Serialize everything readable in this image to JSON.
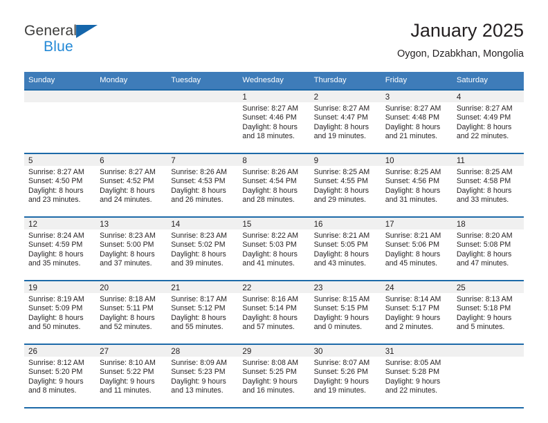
{
  "brand": {
    "line1": "General",
    "line2": "Blue",
    "triangle_color": "#1566ab",
    "line2_color": "#2288d6"
  },
  "header": {
    "title": "January 2025",
    "subtitle": "Oygon, Dzabkhan, Mongolia"
  },
  "theme": {
    "header_bg": "#3e7cb9",
    "row_rule": "#1c69a8",
    "daynum_band": "#f0f0f0",
    "text": "#231f20"
  },
  "weekday_headers": [
    "Sunday",
    "Monday",
    "Tuesday",
    "Wednesday",
    "Thursday",
    "Friday",
    "Saturday"
  ],
  "weeks": [
    [
      {
        "day": "",
        "sunrise": "",
        "sunset": "",
        "daylight1": "",
        "daylight2": ""
      },
      {
        "day": "",
        "sunrise": "",
        "sunset": "",
        "daylight1": "",
        "daylight2": ""
      },
      {
        "day": "",
        "sunrise": "",
        "sunset": "",
        "daylight1": "",
        "daylight2": ""
      },
      {
        "day": "1",
        "sunrise": "Sunrise: 8:27 AM",
        "sunset": "Sunset: 4:46 PM",
        "daylight1": "Daylight: 8 hours",
        "daylight2": "and 18 minutes."
      },
      {
        "day": "2",
        "sunrise": "Sunrise: 8:27 AM",
        "sunset": "Sunset: 4:47 PM",
        "daylight1": "Daylight: 8 hours",
        "daylight2": "and 19 minutes."
      },
      {
        "day": "3",
        "sunrise": "Sunrise: 8:27 AM",
        "sunset": "Sunset: 4:48 PM",
        "daylight1": "Daylight: 8 hours",
        "daylight2": "and 21 minutes."
      },
      {
        "day": "4",
        "sunrise": "Sunrise: 8:27 AM",
        "sunset": "Sunset: 4:49 PM",
        "daylight1": "Daylight: 8 hours",
        "daylight2": "and 22 minutes."
      }
    ],
    [
      {
        "day": "5",
        "sunrise": "Sunrise: 8:27 AM",
        "sunset": "Sunset: 4:50 PM",
        "daylight1": "Daylight: 8 hours",
        "daylight2": "and 23 minutes."
      },
      {
        "day": "6",
        "sunrise": "Sunrise: 8:27 AM",
        "sunset": "Sunset: 4:52 PM",
        "daylight1": "Daylight: 8 hours",
        "daylight2": "and 24 minutes."
      },
      {
        "day": "7",
        "sunrise": "Sunrise: 8:26 AM",
        "sunset": "Sunset: 4:53 PM",
        "daylight1": "Daylight: 8 hours",
        "daylight2": "and 26 minutes."
      },
      {
        "day": "8",
        "sunrise": "Sunrise: 8:26 AM",
        "sunset": "Sunset: 4:54 PM",
        "daylight1": "Daylight: 8 hours",
        "daylight2": "and 28 minutes."
      },
      {
        "day": "9",
        "sunrise": "Sunrise: 8:25 AM",
        "sunset": "Sunset: 4:55 PM",
        "daylight1": "Daylight: 8 hours",
        "daylight2": "and 29 minutes."
      },
      {
        "day": "10",
        "sunrise": "Sunrise: 8:25 AM",
        "sunset": "Sunset: 4:56 PM",
        "daylight1": "Daylight: 8 hours",
        "daylight2": "and 31 minutes."
      },
      {
        "day": "11",
        "sunrise": "Sunrise: 8:25 AM",
        "sunset": "Sunset: 4:58 PM",
        "daylight1": "Daylight: 8 hours",
        "daylight2": "and 33 minutes."
      }
    ],
    [
      {
        "day": "12",
        "sunrise": "Sunrise: 8:24 AM",
        "sunset": "Sunset: 4:59 PM",
        "daylight1": "Daylight: 8 hours",
        "daylight2": "and 35 minutes."
      },
      {
        "day": "13",
        "sunrise": "Sunrise: 8:23 AM",
        "sunset": "Sunset: 5:00 PM",
        "daylight1": "Daylight: 8 hours",
        "daylight2": "and 37 minutes."
      },
      {
        "day": "14",
        "sunrise": "Sunrise: 8:23 AM",
        "sunset": "Sunset: 5:02 PM",
        "daylight1": "Daylight: 8 hours",
        "daylight2": "and 39 minutes."
      },
      {
        "day": "15",
        "sunrise": "Sunrise: 8:22 AM",
        "sunset": "Sunset: 5:03 PM",
        "daylight1": "Daylight: 8 hours",
        "daylight2": "and 41 minutes."
      },
      {
        "day": "16",
        "sunrise": "Sunrise: 8:21 AM",
        "sunset": "Sunset: 5:05 PM",
        "daylight1": "Daylight: 8 hours",
        "daylight2": "and 43 minutes."
      },
      {
        "day": "17",
        "sunrise": "Sunrise: 8:21 AM",
        "sunset": "Sunset: 5:06 PM",
        "daylight1": "Daylight: 8 hours",
        "daylight2": "and 45 minutes."
      },
      {
        "day": "18",
        "sunrise": "Sunrise: 8:20 AM",
        "sunset": "Sunset: 5:08 PM",
        "daylight1": "Daylight: 8 hours",
        "daylight2": "and 47 minutes."
      }
    ],
    [
      {
        "day": "19",
        "sunrise": "Sunrise: 8:19 AM",
        "sunset": "Sunset: 5:09 PM",
        "daylight1": "Daylight: 8 hours",
        "daylight2": "and 50 minutes."
      },
      {
        "day": "20",
        "sunrise": "Sunrise: 8:18 AM",
        "sunset": "Sunset: 5:11 PM",
        "daylight1": "Daylight: 8 hours",
        "daylight2": "and 52 minutes."
      },
      {
        "day": "21",
        "sunrise": "Sunrise: 8:17 AM",
        "sunset": "Sunset: 5:12 PM",
        "daylight1": "Daylight: 8 hours",
        "daylight2": "and 55 minutes."
      },
      {
        "day": "22",
        "sunrise": "Sunrise: 8:16 AM",
        "sunset": "Sunset: 5:14 PM",
        "daylight1": "Daylight: 8 hours",
        "daylight2": "and 57 minutes."
      },
      {
        "day": "23",
        "sunrise": "Sunrise: 8:15 AM",
        "sunset": "Sunset: 5:15 PM",
        "daylight1": "Daylight: 9 hours",
        "daylight2": "and 0 minutes."
      },
      {
        "day": "24",
        "sunrise": "Sunrise: 8:14 AM",
        "sunset": "Sunset: 5:17 PM",
        "daylight1": "Daylight: 9 hours",
        "daylight2": "and 2 minutes."
      },
      {
        "day": "25",
        "sunrise": "Sunrise: 8:13 AM",
        "sunset": "Sunset: 5:18 PM",
        "daylight1": "Daylight: 9 hours",
        "daylight2": "and 5 minutes."
      }
    ],
    [
      {
        "day": "26",
        "sunrise": "Sunrise: 8:12 AM",
        "sunset": "Sunset: 5:20 PM",
        "daylight1": "Daylight: 9 hours",
        "daylight2": "and 8 minutes."
      },
      {
        "day": "27",
        "sunrise": "Sunrise: 8:10 AM",
        "sunset": "Sunset: 5:22 PM",
        "daylight1": "Daylight: 9 hours",
        "daylight2": "and 11 minutes."
      },
      {
        "day": "28",
        "sunrise": "Sunrise: 8:09 AM",
        "sunset": "Sunset: 5:23 PM",
        "daylight1": "Daylight: 9 hours",
        "daylight2": "and 13 minutes."
      },
      {
        "day": "29",
        "sunrise": "Sunrise: 8:08 AM",
        "sunset": "Sunset: 5:25 PM",
        "daylight1": "Daylight: 9 hours",
        "daylight2": "and 16 minutes."
      },
      {
        "day": "30",
        "sunrise": "Sunrise: 8:07 AM",
        "sunset": "Sunset: 5:26 PM",
        "daylight1": "Daylight: 9 hours",
        "daylight2": "and 19 minutes."
      },
      {
        "day": "31",
        "sunrise": "Sunrise: 8:05 AM",
        "sunset": "Sunset: 5:28 PM",
        "daylight1": "Daylight: 9 hours",
        "daylight2": "and 22 minutes."
      },
      {
        "day": "",
        "sunrise": "",
        "sunset": "",
        "daylight1": "",
        "daylight2": ""
      }
    ]
  ]
}
